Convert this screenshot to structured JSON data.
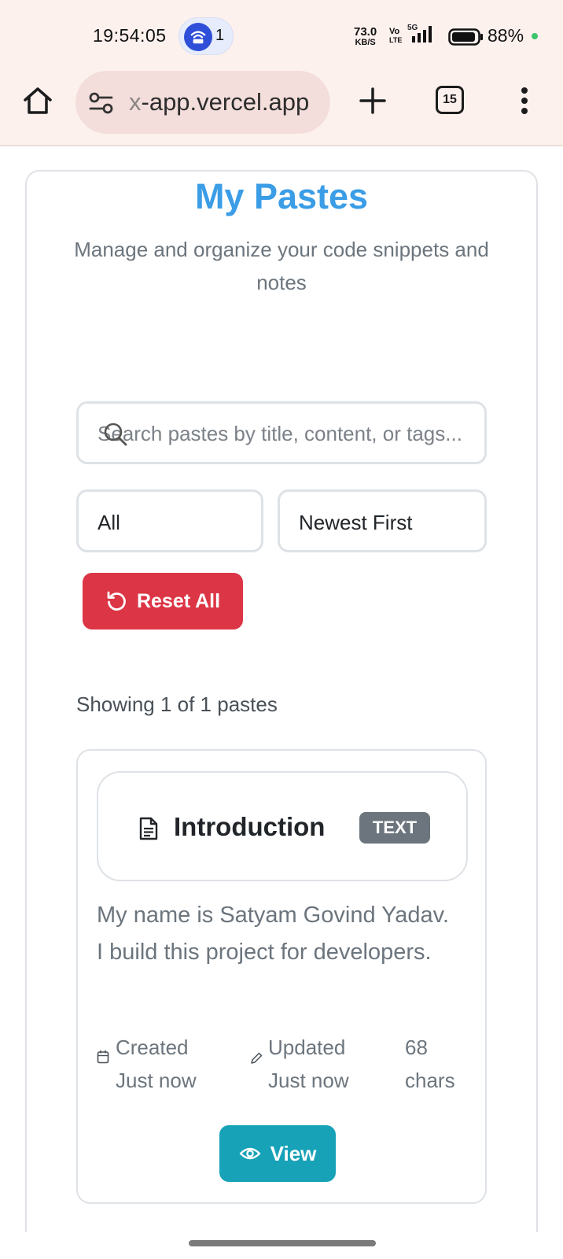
{
  "status_bar": {
    "time": "19:54:05",
    "notification_count": "1",
    "net_speed_value": "73.0",
    "net_speed_unit": "KB/S",
    "volte_top": "Vo",
    "volte_bottom": "LTE",
    "network": "5G",
    "battery_percent": "88%"
  },
  "browser": {
    "url_prefix": "x",
    "url_rest": "-app.vercel.app",
    "tab_count": "15"
  },
  "page": {
    "title": "My Pastes",
    "subtitle": "Manage and organize your code snippets and notes"
  },
  "filters": {
    "search_placeholder": "Search pastes by title, content, or tags...",
    "type_value": "All",
    "sort_value": "Newest First",
    "reset_label": "Reset All"
  },
  "results": {
    "showing_text": "Showing 1 of 1 pastes"
  },
  "pastes": [
    {
      "title": "Introduction",
      "badge": "TEXT",
      "content": "My name is Satyam Govind Yadav. I build this project for developers.",
      "created_label": "Created",
      "created_value": "Just now",
      "updated_label": "Updated",
      "updated_value": "Just now",
      "chars_count": "68",
      "chars_label": "chars",
      "view_label": "View"
    }
  ],
  "colors": {
    "title_blue": "#3b9de6",
    "reset_red": "#dc3545",
    "view_teal": "#17a2b8",
    "badge_gray": "#6c757d"
  }
}
